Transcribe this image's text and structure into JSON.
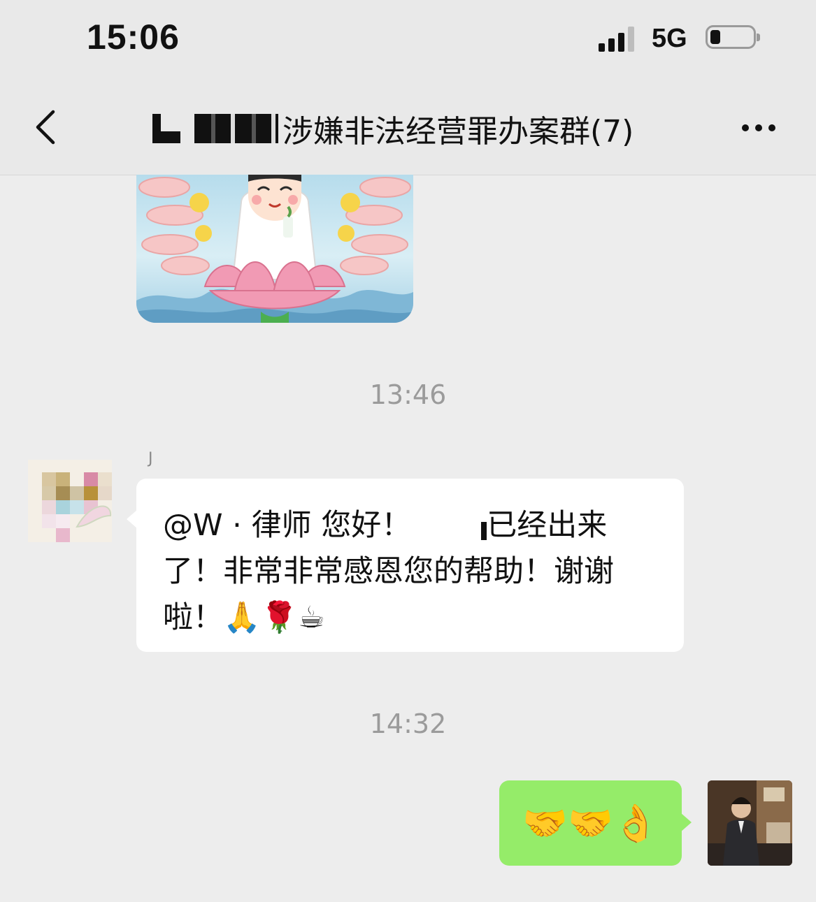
{
  "status_bar": {
    "time": "15:06",
    "network": "5G",
    "signal_icon": "cellular-signal-icon",
    "battery_icon": "battery-low-icon"
  },
  "nav": {
    "back_icon": "chevron-left-icon",
    "title": "涉嫌非法经营罪办案群(7)",
    "more_icon": "more-dots-icon"
  },
  "messages": [
    {
      "type": "sticker",
      "direction": "incoming"
    },
    {
      "type": "timestamp",
      "text": "13:46"
    },
    {
      "type": "text",
      "direction": "incoming",
      "sender": "J",
      "text_before_mask": "@W · 律师 您好！",
      "text_after_mask": "已经出来了！非常非常感恩您的帮助！谢谢啦！",
      "emojis": "🙏🌹☕"
    },
    {
      "type": "timestamp",
      "text": "14:32"
    },
    {
      "type": "text",
      "direction": "outgoing",
      "emojis": "🤝🤝👌"
    }
  ],
  "colors": {
    "background": "#ededed",
    "bubble_incoming": "#ffffff",
    "bubble_outgoing": "#95ec69",
    "timestamp": "#9b9b9b"
  }
}
